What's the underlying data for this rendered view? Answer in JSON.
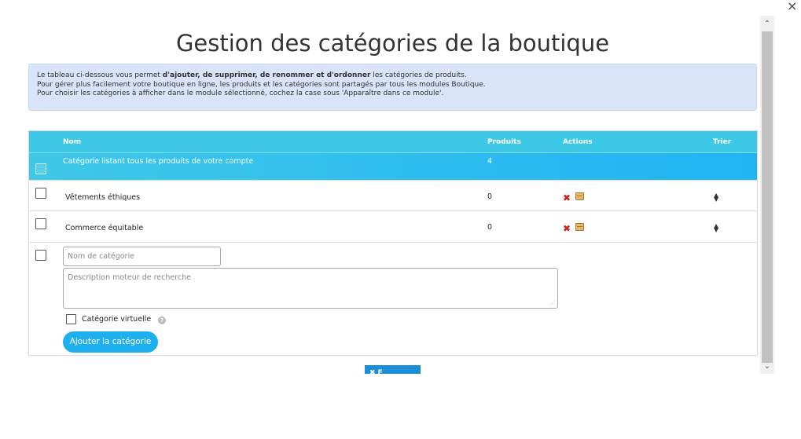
{
  "window": {
    "close_glyph": "×"
  },
  "page": {
    "title": "Gestion des catégories de la boutique"
  },
  "info": {
    "line1_pre": "Le tableau ci-dessous vous permet ",
    "line1_bold": "d'ajouter, de supprimer, de renommer et d'ordonner",
    "line1_post": " les catégories de produits.",
    "line2": "Pour gérer plus facilement votre boutique en ligne, les produits et les catégories sont partagés par tous les modules Boutique.",
    "line3": "Pour choisir les catégories à afficher dans le module sélectionné, cochez la case sous 'Apparaître dans ce module'."
  },
  "table": {
    "headers": {
      "nom": "Nom",
      "produits": "Produits",
      "actions": "Actions",
      "trier": "Trier"
    },
    "all_row": {
      "label": "Catégorie listant tous les produits de votre compte",
      "count": "4"
    },
    "rows": [
      {
        "name": "Vêtements éthiques",
        "count": "0"
      },
      {
        "name": "Commerce équitable",
        "count": "0"
      }
    ],
    "icons": {
      "delete": "✖",
      "sort": "⬍"
    }
  },
  "add_form": {
    "name_placeholder": "Nom de catégorie",
    "description_placeholder": "Description moteur de recherche",
    "virtual_label": "Catégorie virtuelle",
    "help_glyph": "?",
    "submit_label": "Ajouter la catégorie"
  },
  "colors": {
    "header": "#3ec8e8",
    "accent": "#1eb0ee",
    "info_bg": "#d9e4fa",
    "delete": "#d0201a"
  }
}
